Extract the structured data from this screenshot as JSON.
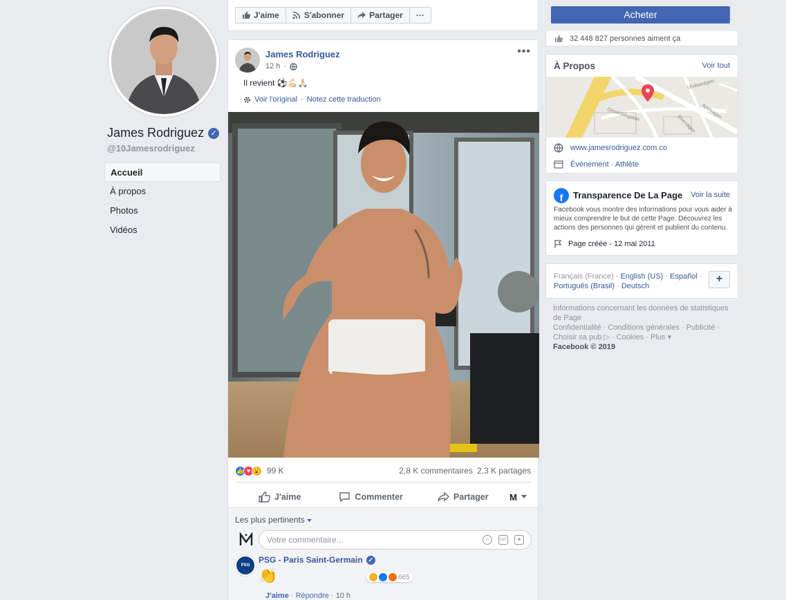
{
  "left": {
    "page_name": "James Rodriguez",
    "page_handle": "@10Jamesrodriguez",
    "nav": [
      "Accueil",
      "À propos",
      "Photos",
      "Vidéos"
    ]
  },
  "actions": {
    "like": "J'aime",
    "follow": "S'abonner",
    "share": "Partager",
    "more": "···"
  },
  "post": {
    "author": "James Rodriguez",
    "time": "12 h",
    "text": "Il revient ⚽💪🏻🙏🏻",
    "see_original": "Voir l'original",
    "rate_translation": "Notez cette traduction",
    "reaction_count": "99 K",
    "comments_count": "2,8 K commentaires",
    "shares_count": "2,3 K partages",
    "like_label": "J'aime",
    "comment_label": "Commenter",
    "share_label": "Partager",
    "sort_label": "Les plus pertinents",
    "comment_placeholder": "Votre commentaire...",
    "top_comment": {
      "author": "PSG - Paris Saint-Germain",
      "reaction_count": "665",
      "like_label": "J'aime",
      "reply_label": "Répondre",
      "time": "10 h"
    }
  },
  "right": {
    "buy_label": "Acheter",
    "likes_text": "32 448 827 personnes aiment ça",
    "about_title": "À Propos",
    "about_link": "Voir tout",
    "map_labels": [
      "Ulvilsavägen",
      "Omsköldsgatan",
      "Apelvägen",
      "Ekervägen"
    ],
    "website": "www.jamesrodriguez.com.co",
    "category": "Évènement · Athlète",
    "transparency_title": "Transparence De La Page",
    "transparency_link": "Voir la suite",
    "transparency_body": "Facebook vous montre des informations pour vous aider à mieux comprendre le but de cette Page. Découvrez les actions des personnes qui gèrent et publient du contenu.",
    "page_created": "Page créée - 12 mai 2011",
    "lang_current": "Français (France) ·",
    "lang_links": [
      "English (US)",
      "Español",
      "Português (Brasil)",
      "Deutsch"
    ],
    "lang_plus": "+",
    "footer": {
      "line1": "Informations concernant les données de statistiques de Page",
      "line2": "Confidentialité · Conditions générales · Publicité · Choisir sa pub ▷ · Cookies · Plus ▾",
      "copyright": "Facebook © 2019"
    }
  },
  "colors": {
    "brand_blue": "#4267b2",
    "link_blue": "#365899",
    "background": "#e9ebee"
  }
}
